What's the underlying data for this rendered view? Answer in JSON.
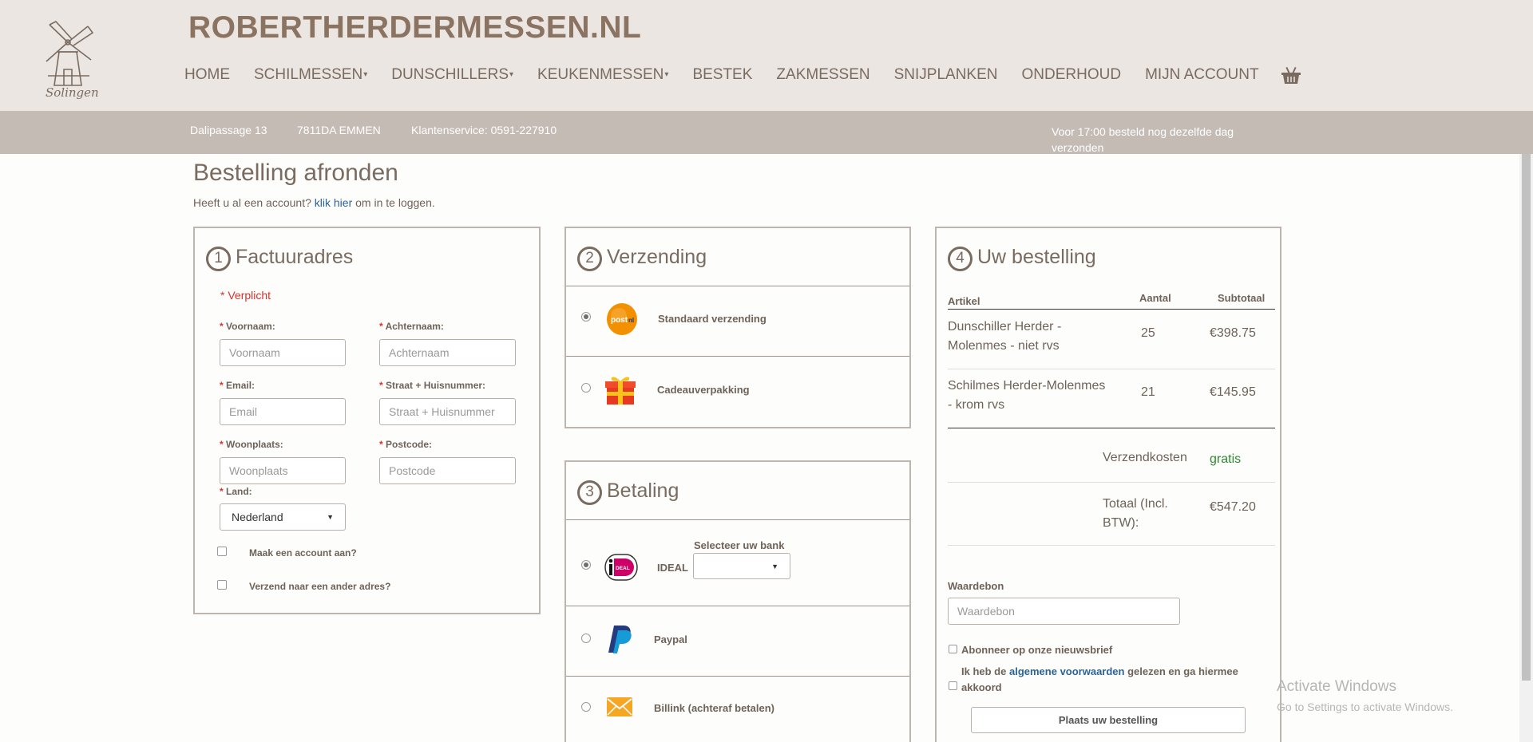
{
  "header": {
    "logo_text": "Solingen",
    "site_title": "ROBERTHERDERMESSEN.NL",
    "nav": [
      {
        "label": "HOME",
        "dropdown": false
      },
      {
        "label": "SCHILMESSEN",
        "dropdown": true
      },
      {
        "label": "DUNSCHILLERS",
        "dropdown": true
      },
      {
        "label": "KEUKENMESSEN",
        "dropdown": true
      },
      {
        "label": "BESTEK",
        "dropdown": false
      },
      {
        "label": "ZAKMESSEN",
        "dropdown": false
      },
      {
        "label": "SNIJPLANKEN",
        "dropdown": false
      },
      {
        "label": "ONDERHOUD",
        "dropdown": false
      },
      {
        "label": "MIJN ACCOUNT",
        "dropdown": false
      }
    ],
    "cart_icon": "basket-icon"
  },
  "infobar": {
    "address": "Dalipassage 13",
    "postal_city": "7811DA EMMEN",
    "service": "Klantenservice: 0591-227910",
    "shipping_note": "Voor 17:00 besteld nog dezelfde dag verzonden"
  },
  "page": {
    "title": "Bestelling afronden",
    "login_prefix": "Heeft u al een account?",
    "login_link": "klik hier",
    "login_suffix": "om in te loggen."
  },
  "billing": {
    "number": "1",
    "title": "Factuuradres",
    "required_note": "* Verplicht",
    "star": "*",
    "fields": {
      "first_name": {
        "label": "Voornaam:",
        "placeholder": "Voornaam"
      },
      "last_name": {
        "label": "Achternaam:",
        "placeholder": "Achternaam"
      },
      "email": {
        "label": "Email:",
        "placeholder": "Email"
      },
      "street": {
        "label": "Straat + Huisnummer:",
        "placeholder": "Straat + Huisnummer"
      },
      "city": {
        "label": "Woonplaats:",
        "placeholder": "Woonplaats"
      },
      "postcode": {
        "label": "Postcode:",
        "placeholder": "Postcode"
      },
      "country": {
        "label": "Land:",
        "value": "Nederland"
      }
    },
    "create_account": "Maak een account aan?",
    "ship_other": "Verzend naar een ander adres?"
  },
  "shipping": {
    "number": "2",
    "title": "Verzending",
    "options": [
      {
        "label": "Standaard verzending",
        "icon": "postnl-icon",
        "selected": true
      },
      {
        "label": "Cadeauverpakking",
        "icon": "gift-icon",
        "selected": false
      }
    ]
  },
  "payment": {
    "number": "3",
    "title": "Betaling",
    "bank_label": "Selecteer uw bank",
    "bank_value": "",
    "options": [
      {
        "label": "IDEAL",
        "icon": "ideal-icon",
        "selected": true
      },
      {
        "label": "Paypal",
        "icon": "paypal-icon",
        "selected": false
      },
      {
        "label": "Billink (achteraf betalen)",
        "icon": "envelope-icon",
        "selected": false
      }
    ]
  },
  "order": {
    "number": "4",
    "title": "Uw bestelling",
    "columns": [
      "Artikel",
      "Aantal",
      "Subtotaal"
    ],
    "rows": [
      {
        "article": "Dunschiller Herder - Molenmes - niet rvs",
        "qty": "25",
        "subtotal": "€398.75"
      },
      {
        "article": "Schilmes Herder-Molenmes - krom rvs",
        "qty": "21",
        "subtotal": "€145.95"
      }
    ],
    "shipping_label": "Verzendkosten",
    "shipping_value": "gratis",
    "total_label": "Totaal (Incl. BTW):",
    "total_value": "€547.20",
    "voucher_label": "Waardebon",
    "voucher_placeholder": "Waardebon",
    "newsletter": "Abonneer op onze nieuwsbrief",
    "terms_prefix": "Ik heb de",
    "terms_link": "algemene voorwaarden",
    "terms_suffix": "gelezen en ga hiermee akkoord",
    "place_order": "Plaats uw bestelling"
  },
  "watermark": {
    "line1": "Activate Windows",
    "line2": "Go to Settings to activate Windows."
  },
  "colors": {
    "accent": "#8b7362",
    "header_bg": "#ebe6e2",
    "infobar_bg": "#c4bbb5",
    "required": "#d9312b",
    "link": "#2a6496",
    "free": "#2e8b2e"
  }
}
